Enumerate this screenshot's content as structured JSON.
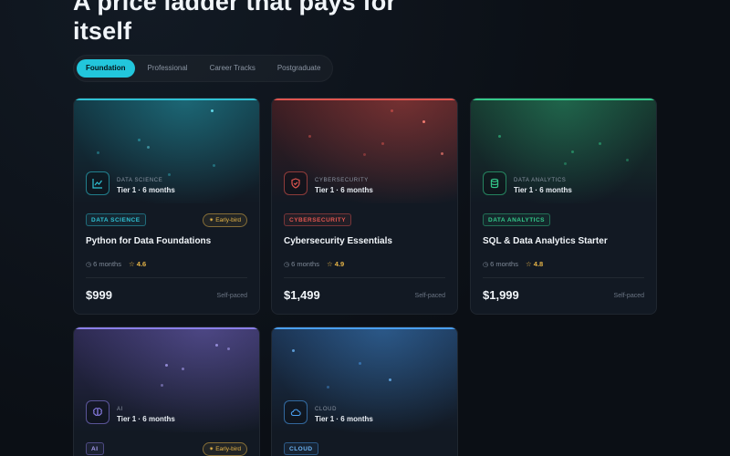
{
  "headline": "A price ladder that pays for itself",
  "tabs": [
    "Foundation",
    "Professional",
    "Career Tracks",
    "Postgraduate"
  ],
  "active_tab": "Foundation",
  "cards": [
    {
      "category_small": "DATA SCIENCE",
      "tier": "Tier 1 · 6 months",
      "badge": "DATA SCIENCE",
      "early_bird": "Early-bird",
      "title": "Python for Data Foundations",
      "duration": "6 months",
      "rating": "4.6",
      "price": "$999",
      "pace": "Self-paced",
      "icon": "line-chart-icon",
      "accent": "#2fc1d4"
    },
    {
      "category_small": "CYBERSECURITY",
      "tier": "Tier 1 · 6 months",
      "badge": "CYBERSECURITY",
      "title": "Cybersecurity Essentials",
      "duration": "6 months",
      "rating": "4.9",
      "price": "$1,499",
      "pace": "Self-paced",
      "icon": "shield-icon",
      "accent": "#e0554f"
    },
    {
      "category_small": "DATA ANALYTICS",
      "tier": "Tier 1 · 6 months",
      "badge": "DATA ANALYTICS",
      "title": "SQL & Data Analytics Starter",
      "duration": "6 months",
      "rating": "4.8",
      "price": "$1,999",
      "pace": "Self-paced",
      "icon": "database-icon",
      "accent": "#34c98a"
    },
    {
      "category_small": "AI",
      "tier": "Tier 1 · 6 months",
      "badge": "AI",
      "early_bird": "Early-bird",
      "icon": "brain-icon",
      "accent": "#8b7fe8"
    },
    {
      "category_small": "CLOUD",
      "tier": "Tier 1 · 6 months",
      "badge": "CLOUD",
      "icon": "cloud-icon",
      "accent": "#4a9ff0"
    }
  ]
}
